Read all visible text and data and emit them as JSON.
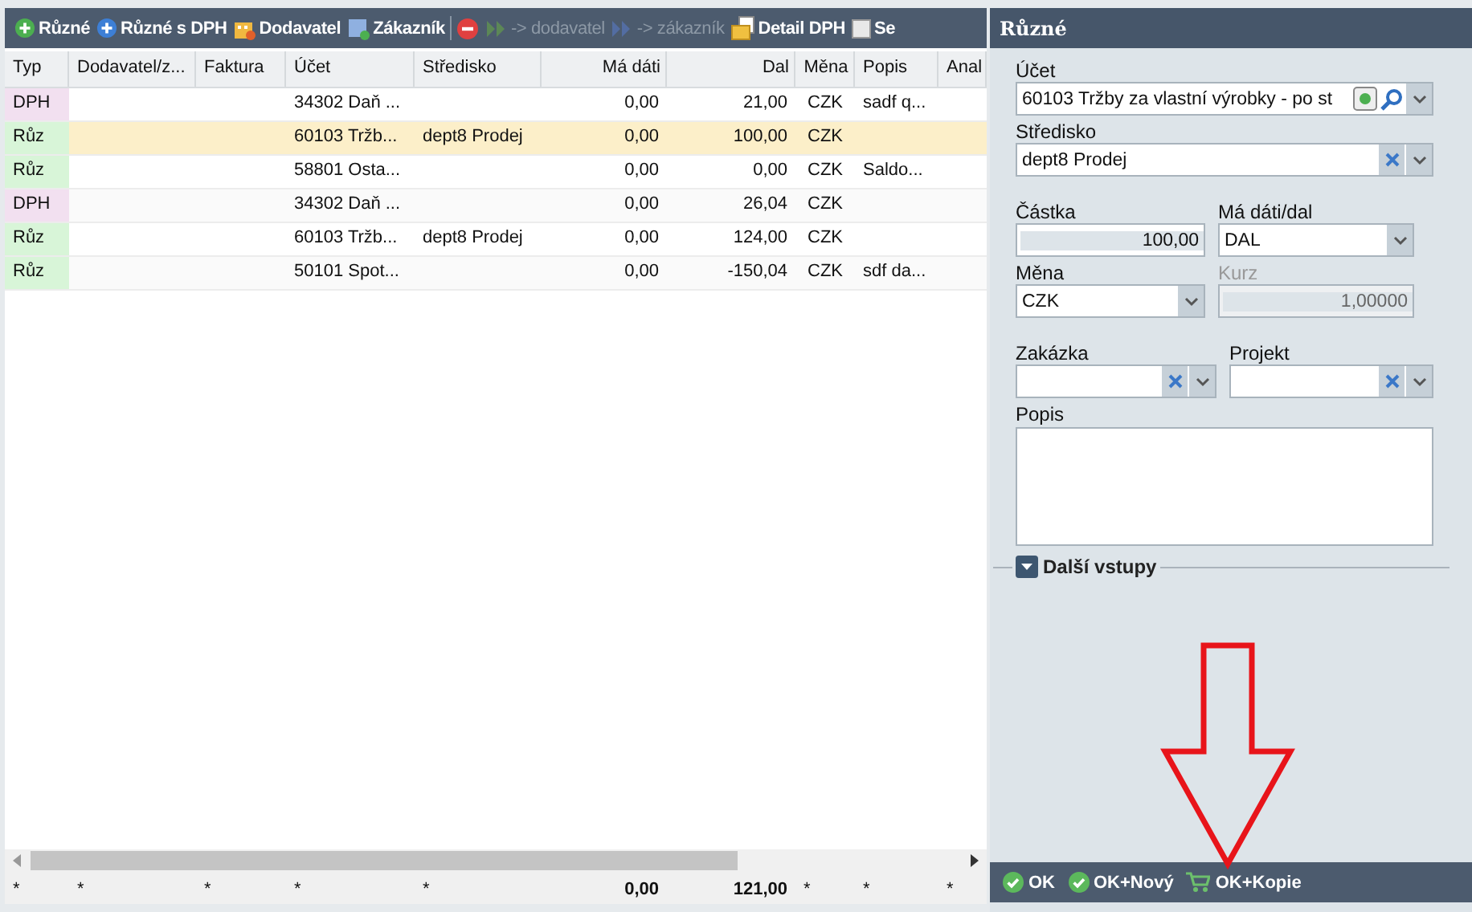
{
  "toolbar": [
    {
      "label": "Různé",
      "disabled": false
    },
    {
      "label": "Různé s DPH",
      "disabled": false
    },
    {
      "label": "Dodavatel",
      "disabled": false
    },
    {
      "label": "Zákazník",
      "disabled": false
    },
    {
      "disabled": false
    },
    {
      "label": "-> dodavatel",
      "disabled": true
    },
    {
      "label": "-> zákazník",
      "disabled": true
    },
    {
      "label": "Detail DPH",
      "disabled": false
    },
    {
      "label": "Se",
      "disabled": false
    }
  ],
  "table": {
    "columns": [
      "Typ",
      "Dodavatel/z...",
      "Faktura",
      "Účet",
      "Středisko",
      "Má dáti",
      "Dal",
      "Měna",
      "Popis",
      "Anal"
    ],
    "rows": [
      {
        "kind": "dph",
        "selected": false,
        "cells": [
          "DPH",
          "",
          "",
          "34302 Daň ...",
          "",
          "0,00",
          "21,00",
          "CZK",
          "sadf q...",
          ""
        ]
      },
      {
        "kind": "ruz",
        "selected": true,
        "cells": [
          "Růz",
          "",
          "",
          "60103 Tržb...",
          "dept8 Prodej",
          "0,00",
          "100,00",
          "CZK",
          "",
          ""
        ]
      },
      {
        "kind": "ruz",
        "selected": false,
        "cells": [
          "Růz",
          "",
          "",
          "58801 Osta...",
          "",
          "0,00",
          "0,00",
          "CZK",
          "Saldo...",
          ""
        ]
      },
      {
        "kind": "dph",
        "selected": false,
        "cells": [
          "DPH",
          "",
          "",
          "34302 Daň ...",
          "",
          "0,00",
          "26,04",
          "CZK",
          "",
          ""
        ]
      },
      {
        "kind": "ruz",
        "selected": false,
        "cells": [
          "Růz",
          "",
          "",
          "60103 Tržb...",
          "dept8 Prodej",
          "0,00",
          "124,00",
          "CZK",
          "",
          ""
        ]
      },
      {
        "kind": "ruz",
        "selected": false,
        "cells": [
          "Růz",
          "",
          "",
          "50101 Spot...",
          "",
          "0,00",
          "-150,04",
          "CZK",
          "sdf da...",
          ""
        ]
      }
    ],
    "totals": [
      "*",
      "*",
      "*",
      "*",
      "*",
      "0,00",
      "121,00",
      "*",
      "*",
      "*"
    ]
  },
  "form": {
    "title": "Různé",
    "ucet": {
      "label": "Účet",
      "value": "60103 Tržby za vlastní výrobky - po st"
    },
    "stredisko": {
      "label": "Středisko",
      "value": "dept8 Prodej"
    },
    "castka": {
      "label": "Částka",
      "value": "100,00"
    },
    "ma_dati_dal": {
      "label": "Má dáti/dal",
      "value": "DAL"
    },
    "mena": {
      "label": "Měna",
      "value": "CZK"
    },
    "kurz": {
      "label": "Kurz",
      "value": "1,00000",
      "disabled": true
    },
    "zakazka": {
      "label": "Zakázka"
    },
    "projekt": {
      "label": "Projekt"
    },
    "popis": {
      "label": "Popis"
    },
    "more": {
      "label": "Další vstupy",
      "expanded": false
    },
    "buttons": [
      {
        "label": "OK"
      },
      {
        "label": "OK+Nový"
      },
      {
        "label": "OK+Kopie"
      }
    ]
  }
}
